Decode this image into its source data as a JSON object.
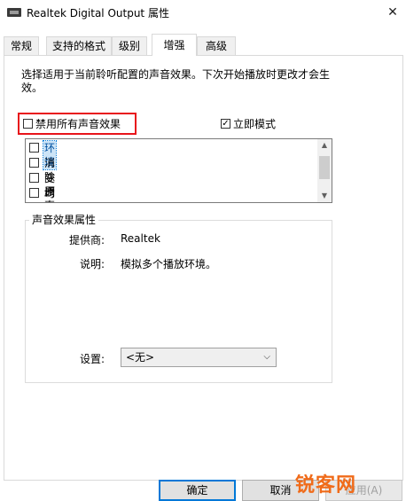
{
  "window": {
    "title": "Realtek Digital Output 属性",
    "close_glyph": "✕"
  },
  "tabs": [
    {
      "label": "常规"
    },
    {
      "label": "支持的格式"
    },
    {
      "label": "级别"
    },
    {
      "label": "增强",
      "active": true
    },
    {
      "label": "高级"
    }
  ],
  "enhance": {
    "description": "选择适用于当前聆听配置的声音效果。下次开始播放时更改才会生效。",
    "disable_all_label": "禁用所有声音效果",
    "disable_all_checked": false,
    "immediate_mode_label": "立即模式",
    "immediate_mode_checked": true,
    "effects": [
      {
        "label": "环境",
        "checked": false,
        "selected": true
      },
      {
        "label": "消除原声",
        "checked": false
      },
      {
        "label": "变调",
        "checked": false
      },
      {
        "label": "均衡器",
        "checked": false
      },
      {
        "label": "...",
        "checked": false
      }
    ],
    "properties": {
      "group_title": "声音效果属性",
      "provider_key": "提供商:",
      "provider_value": "Realtek",
      "description_key": "说明:",
      "description_value": "模拟多个播放环境。",
      "settings_key": "设置:",
      "settings_value": "<无>"
    }
  },
  "buttons": {
    "ok": "确定",
    "cancel": "取消",
    "apply": "应用(A)"
  },
  "watermark": "锐客网",
  "colors": {
    "highlight_border": "#e8141b",
    "selection_bg": "#cce4f7",
    "default_button_border": "#0078d7",
    "watermark": "#f06b1a"
  }
}
